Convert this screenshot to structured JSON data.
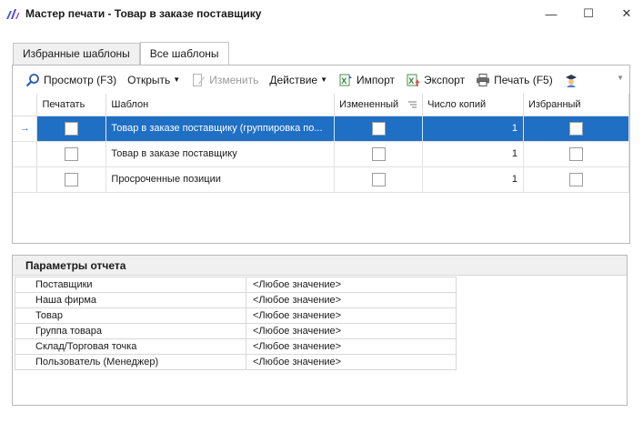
{
  "window": {
    "title": "Мастер печати - Товар в заказе поставщику",
    "minimize_glyph": "—",
    "maximize_glyph": "☐",
    "close_glyph": "✕"
  },
  "tabs": [
    {
      "label": "Избранные шаблоны",
      "active": false
    },
    {
      "label": "Все шаблоны",
      "active": true
    }
  ],
  "toolbar": {
    "preview_label": "Просмотр (F3)",
    "open_label": "Открыть",
    "edit_label": "Изменить",
    "action_label": "Действие",
    "import_label": "Импорт",
    "export_label": "Экспорт",
    "print_label": "Печать (F5)"
  },
  "grid": {
    "columns": [
      "Печатать",
      "Шаблон",
      "Измененный",
      "Число копий",
      "Избранный"
    ],
    "rows": [
      {
        "print": false,
        "template": "Товар в заказе поставщику (группировка по...",
        "changed": false,
        "copies": "1",
        "favorite": false,
        "selected": true
      },
      {
        "print": false,
        "template": "Товар в заказе поставщику",
        "changed": false,
        "copies": "1",
        "favorite": false,
        "selected": false
      },
      {
        "print": false,
        "template": "Просроченные позиции",
        "changed": false,
        "copies": "1",
        "favorite": false,
        "selected": false
      }
    ],
    "row_indicator": "→"
  },
  "params": {
    "title": "Параметры отчета",
    "rows": [
      {
        "name": "Поставщики",
        "value": "<Любое значение>"
      },
      {
        "name": "Наша фирма",
        "value": "<Любое значение>"
      },
      {
        "name": "Товар",
        "value": "<Любое значение>"
      },
      {
        "name": "Группа товара",
        "value": "<Любое значение>"
      },
      {
        "name": "Склад/Торговая точка",
        "value": "<Любое значение>"
      },
      {
        "name": "Пользователь (Менеджер)",
        "value": "<Любое значение>"
      }
    ]
  },
  "colors": {
    "selection": "#1f6fc5",
    "accent": "#2b6cc4"
  }
}
